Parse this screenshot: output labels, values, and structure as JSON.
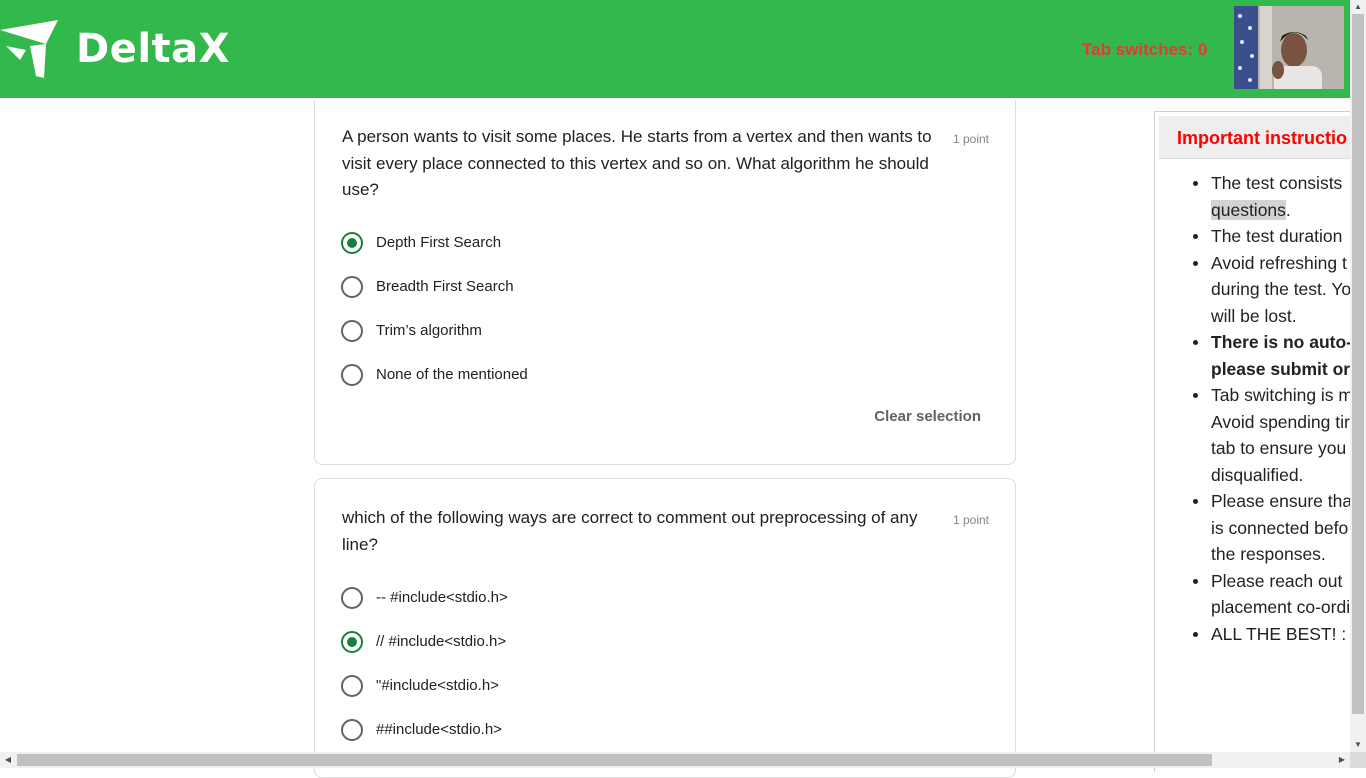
{
  "header": {
    "brand": "DeltaX",
    "tab_switches": "Tab switches: 0",
    "colors": {
      "bar": "#33b84c",
      "alert": "#e53935"
    }
  },
  "questions": [
    {
      "text": "A person wants to visit some places. He starts from a vertex and then wants to visit every place connected to this vertex and so on. What algorithm he should use?",
      "points": "1 point",
      "options": [
        "Depth First Search",
        "Breadth First Search",
        "Trim’s algorithm",
        "None of the mentioned"
      ],
      "selected": "Depth First Search",
      "clear_label": "Clear selection"
    },
    {
      "text": "which of the following ways are correct to comment out preprocessing of any line?",
      "points": "1 point",
      "options": [
        "-- #include<stdio.h>",
        "// #include<stdio.h>",
        "\"#include<stdio.h>",
        "##include<stdio.h>"
      ],
      "selected": "// #include<stdio.h>"
    }
  ],
  "instructions": {
    "title": "Important instructio",
    "items": [
      {
        "l1": "The test consists",
        "l2": "questions",
        "l2_tail": "."
      },
      {
        "l1": "The test duration"
      },
      {
        "l1": "Avoid refreshing t",
        "l2": "during the test. Yo",
        "l3": "will be lost."
      },
      {
        "l1": "There is no auto-",
        "l2": "please submit or"
      },
      {
        "l1": "Tab switching is m",
        "l2": "Avoid spending tir",
        "l3": "tab to ensure you",
        "l4": "disqualified."
      },
      {
        "l1": "Please ensure tha",
        "l2": "is connected befo",
        "l3": "the responses."
      },
      {
        "l1": "Please reach out",
        "l2": "placement co-ordi"
      },
      {
        "l1": "ALL THE BEST! :"
      }
    ]
  }
}
